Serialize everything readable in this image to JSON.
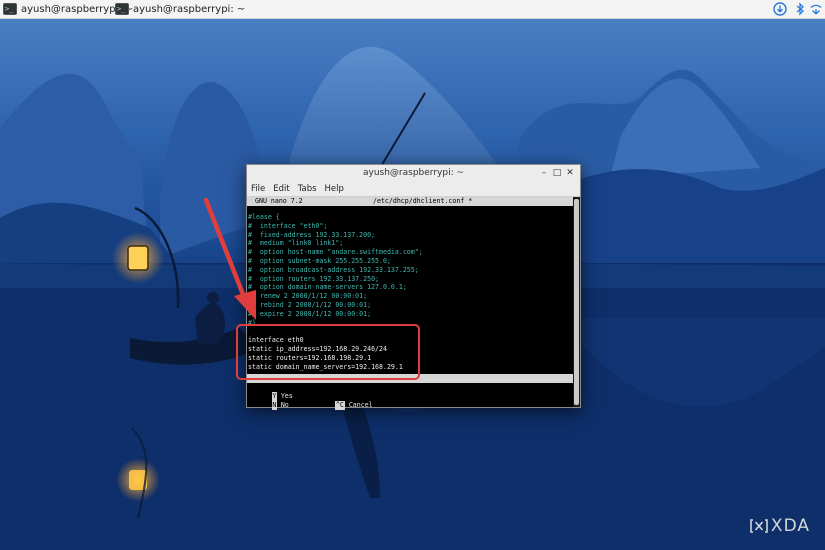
{
  "taskbar": {
    "tasks": [
      {
        "label": "ayush@raspberrypi: ~",
        "icon": "terminal-icon"
      },
      {
        "label": "ayush@raspberrypi: ~",
        "icon": "terminal-icon"
      }
    ],
    "tray_icons": [
      "download-icon",
      "bluetooth-icon",
      "network-icon"
    ]
  },
  "window": {
    "title": "ayush@raspberrypi: ~",
    "menu": [
      "File",
      "Edit",
      "Tabs",
      "Help"
    ]
  },
  "nano": {
    "version": "GNU nano 7.2",
    "filename": "/etc/dhcp/dhclient.conf *",
    "lines": [
      {
        "text": "#lease {",
        "type": "comment"
      },
      {
        "text": "#  interface \"eth0\";",
        "type": "comment"
      },
      {
        "text": "#  fixed-address 192.33.137.200;",
        "type": "comment"
      },
      {
        "text": "#  medium \"link0 link1\";",
        "type": "comment"
      },
      {
        "text": "#  option host-name \"andare.swiftmedia.com\";",
        "type": "comment"
      },
      {
        "text": "#  option subnet-mask 255.255.255.0;",
        "type": "comment"
      },
      {
        "text": "#  option broadcast-address 192.33.137.255;",
        "type": "comment"
      },
      {
        "text": "#  option routers 192.33.137.250;",
        "type": "comment"
      },
      {
        "text": "#  option domain-name-servers 127.0.0.1;",
        "type": "comment"
      },
      {
        "text": "#  renew 2 2000/1/12 00:00:01;",
        "type": "comment"
      },
      {
        "text": "#  rebind 2 2000/1/12 00:00:01;",
        "type": "comment"
      },
      {
        "text": "#  expire 2 2000/1/12 00:00:01;",
        "type": "comment"
      },
      {
        "text": "#}",
        "type": "comment"
      },
      {
        "text": "",
        "type": "plain"
      },
      {
        "text": "interface eth0",
        "type": "plain"
      },
      {
        "text": "static ip_address=192.168.29.246/24",
        "type": "plain"
      },
      {
        "text": "static routers=192.168.198.29.1",
        "type": "plain"
      },
      {
        "text": "static domain_name_servers=192.168.29.1",
        "type": "plain"
      }
    ],
    "prompt_options": [
      {
        "key": "Y",
        "label": "Yes"
      },
      {
        "key": "N",
        "label": "No"
      },
      {
        "key": "^C",
        "label": "Cancel"
      }
    ]
  },
  "watermark": "XDA",
  "colors": {
    "highlight": "#e23d3d",
    "comment_text": "#3fb8b0",
    "taskbar_bg": "#f4f4f4"
  }
}
